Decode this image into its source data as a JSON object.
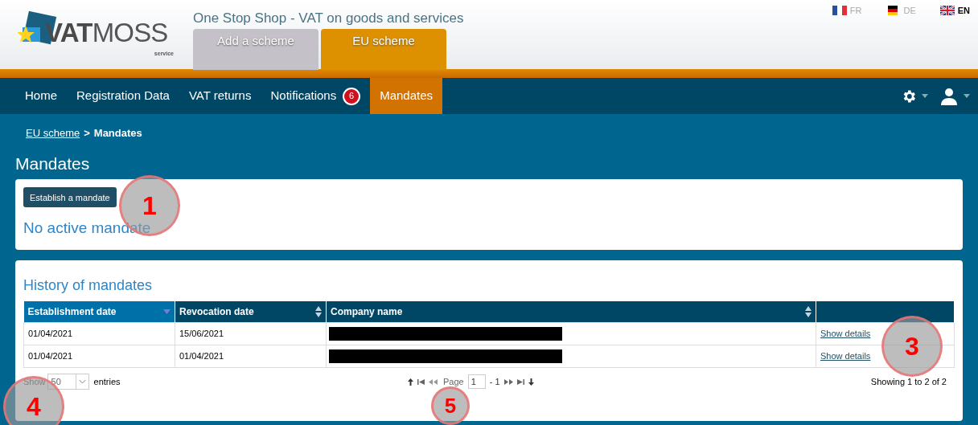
{
  "header": {
    "logo": {
      "text": "VATMOSS",
      "subtitle": "service"
    },
    "title": "One Stop Shop - VAT on goods and services",
    "scheme_tabs": [
      {
        "label": "Add a scheme",
        "selected": false
      },
      {
        "label": "EU scheme",
        "selected": true
      }
    ],
    "languages": [
      {
        "code": "FR",
        "selected": false,
        "kind": "fr"
      },
      {
        "code": "DE",
        "selected": false,
        "kind": "de"
      },
      {
        "code": "EN",
        "selected": true,
        "kind": "gb"
      }
    ]
  },
  "nav": {
    "items": [
      {
        "label": "Home",
        "selected": false
      },
      {
        "label": "Registration Data",
        "selected": false
      },
      {
        "label": "VAT returns",
        "selected": false
      },
      {
        "label": "Notifications",
        "selected": false,
        "badge": "6"
      },
      {
        "label": "Mandates",
        "selected": true
      }
    ]
  },
  "breadcrumb": {
    "link": "EU scheme",
    "separator": ">",
    "current": "Mandates"
  },
  "page_title": "Mandates",
  "active_card": {
    "button": "Establish a mandate",
    "message": "No active mandate"
  },
  "history": {
    "title": "History of mandates",
    "columns": [
      {
        "label": "Establishment date",
        "kind": "sorted"
      },
      {
        "label": "Revocation date",
        "kind": "sortable"
      },
      {
        "label": "Company name",
        "kind": "sortable"
      },
      {
        "kind": "plain"
      }
    ],
    "rows": [
      {
        "establishment": "01/04/2021",
        "revocation": "15/06/2021",
        "company_redacted": true,
        "action": "Show details"
      },
      {
        "establishment": "01/04/2021",
        "revocation": "01/04/2021",
        "company_redacted": true,
        "action": "Show details"
      }
    ],
    "show_label": "Show",
    "page_size": "50",
    "entries_label": "entries",
    "pager": {
      "page_label": "Page",
      "page": "1",
      "total": "- 1"
    },
    "summary": "Showing 1 to 2 of 2"
  },
  "callouts": [
    {
      "label": "1"
    },
    {
      "label": "3"
    },
    {
      "label": "4"
    },
    {
      "label": "5"
    }
  ]
}
